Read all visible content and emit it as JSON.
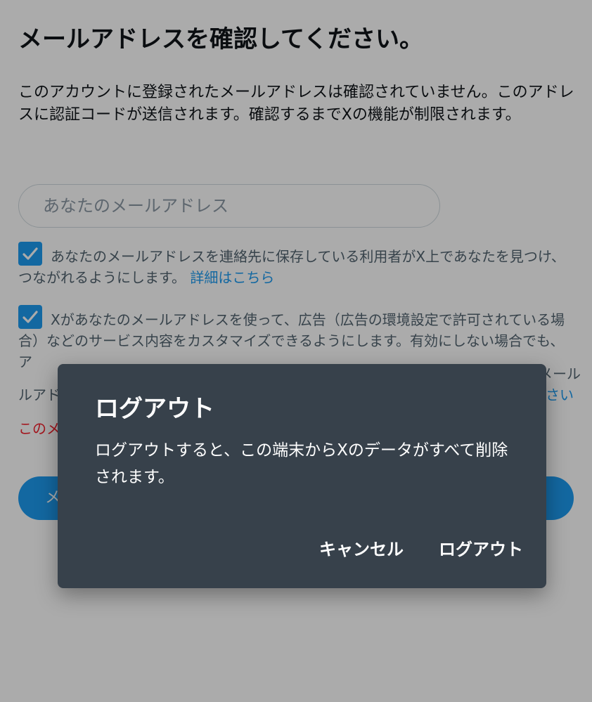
{
  "page": {
    "title": "メールアドレスを確認してください。",
    "description": "このアカウントに登録されたメールアドレスは確認されていません。このアドレスに認証コードが送信されます。確認するまでXの機能が制限されます。",
    "email_placeholder": "あなたのメールアドレス",
    "checkbox1": {
      "text": "あなたのメールアドレスを連絡先に保存している利用者がX上であなたを見つけ、つながれるようにします。",
      "link": "詳細はこちら",
      "checked": true
    },
    "checkbox2": {
      "text": "Xがあなたのメールアドレスを使って、広告（広告の環境設定で許可されている場合）などのサービス内容をカスタマイズできるようにします。有効にしない場合でも、ア",
      "text_right_fragment": "メール",
      "line4_left": "ルアド",
      "line4_right": "さい",
      "checked": true
    },
    "error_fragment": "このメ",
    "primary_button_fragment": "メ"
  },
  "dialog": {
    "title": "ログアウト",
    "message": "ログアウトすると、この端末からXのデータがすべて削除されます。",
    "cancel_label": "キャンセル",
    "confirm_label": "ログアウト"
  },
  "colors": {
    "accent": "#1d9bf0",
    "dialog_bg": "#37414b",
    "error": "#f4212e"
  }
}
